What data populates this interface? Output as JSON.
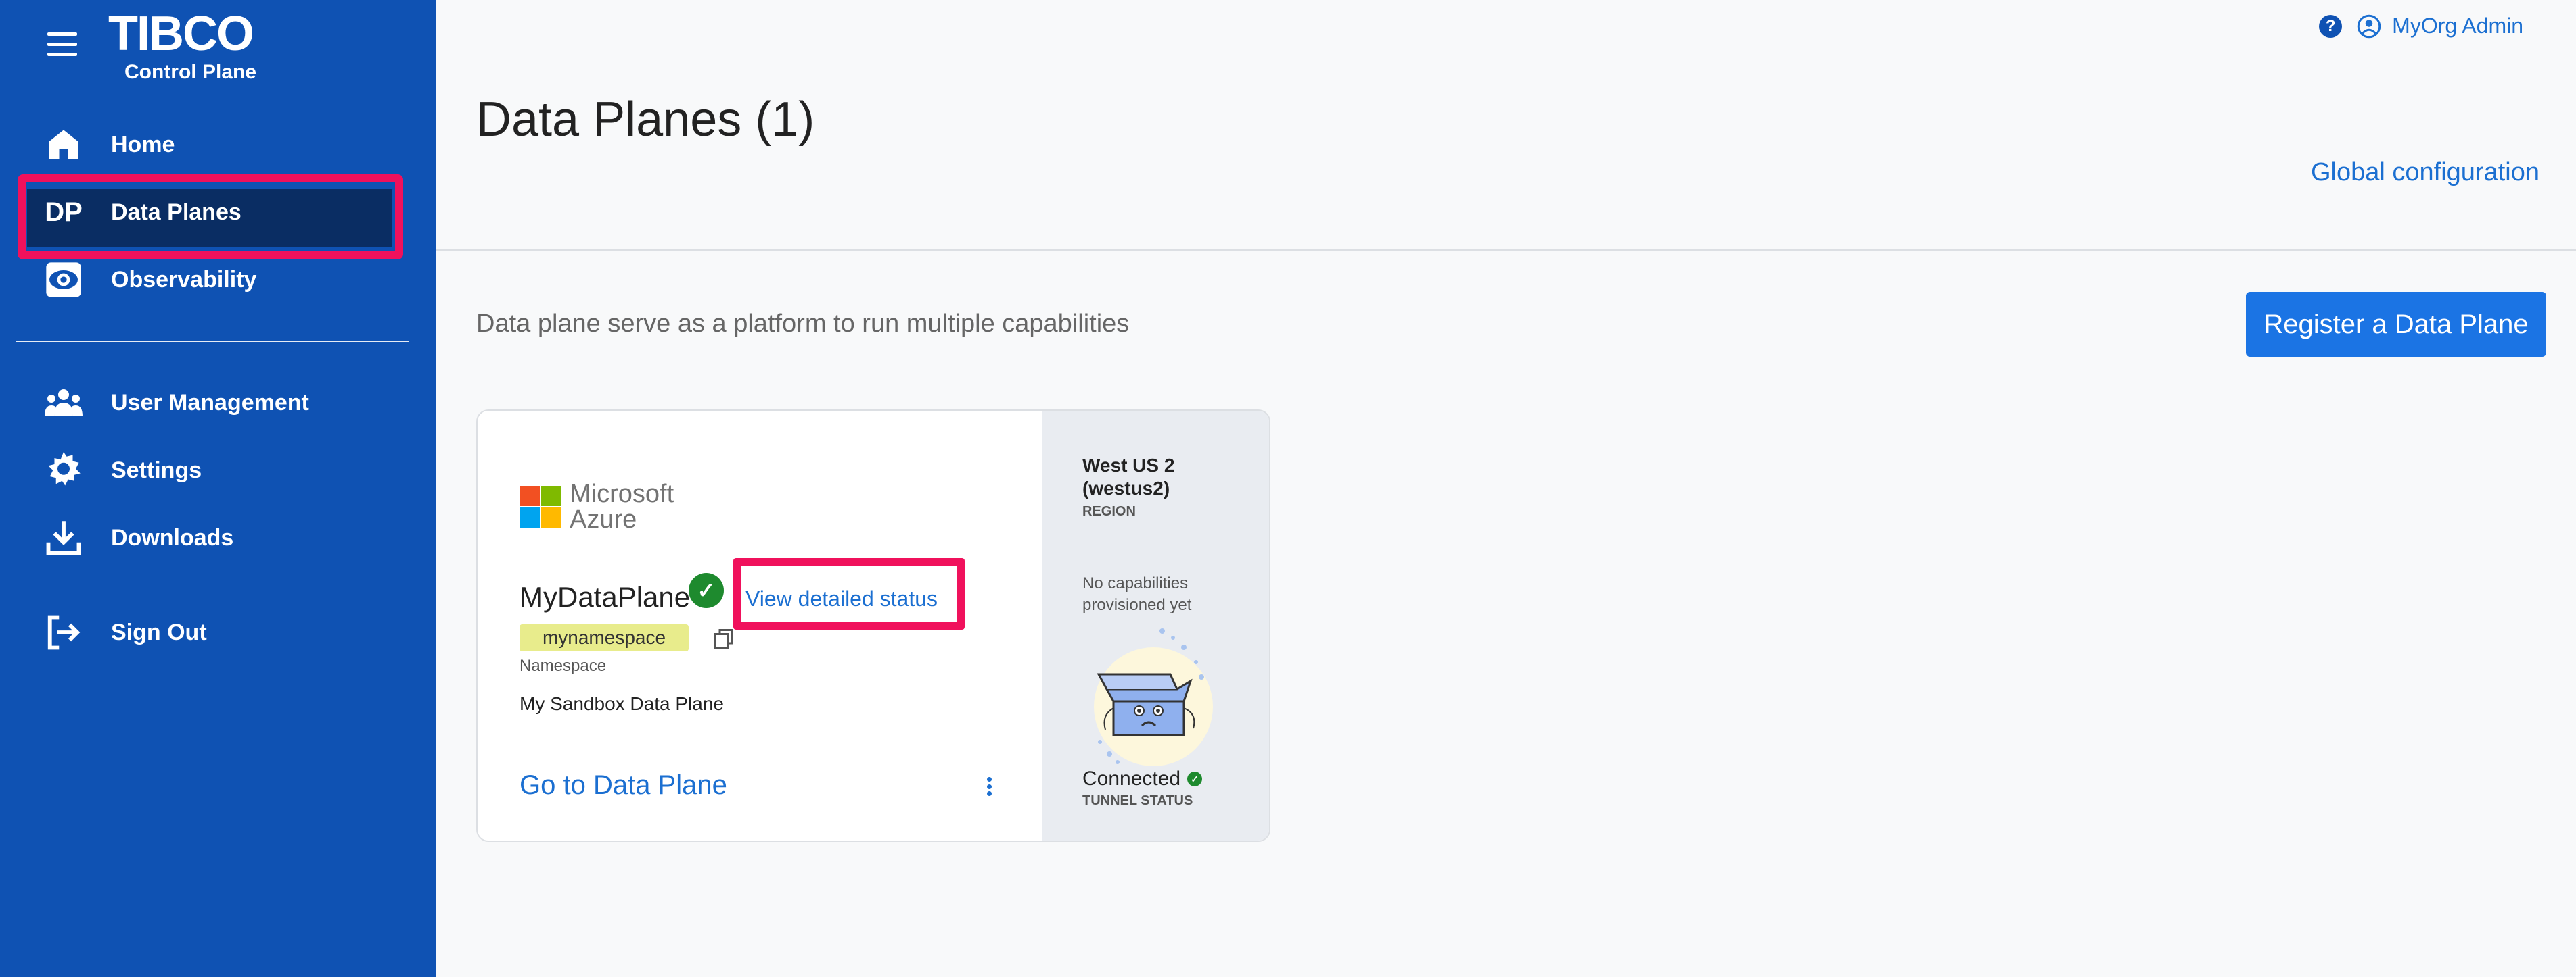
{
  "brand": {
    "name": "TIBCO",
    "sub": "Control Plane"
  },
  "sidebar": {
    "items": [
      {
        "label": "Home",
        "icon": "home-icon"
      },
      {
        "label": "Data Planes",
        "icon": "dp-icon",
        "icon_text": "DP",
        "active": true
      },
      {
        "label": "Observability",
        "icon": "observability-icon"
      },
      {
        "label": "User Management",
        "icon": "users-icon"
      },
      {
        "label": "Settings",
        "icon": "gear-icon"
      },
      {
        "label": "Downloads",
        "icon": "download-icon"
      },
      {
        "label": "Sign Out",
        "icon": "sign-out-icon"
      }
    ]
  },
  "topbar": {
    "help": "?",
    "user": "MyOrg Admin"
  },
  "header": {
    "title": "Data Planes (1)",
    "global_config": "Global configuration",
    "subtitle": "Data plane serve as a platform to run multiple capabilities",
    "register_button": "Register a Data Plane"
  },
  "card": {
    "provider_line1": "Microsoft",
    "provider_line2": "Azure",
    "name": "MyDataPlane",
    "view_status": "View detailed status",
    "namespace": "mynamespace",
    "namespace_label": "Namespace",
    "description": "My Sandbox Data Plane",
    "go_link": "Go to Data Plane",
    "region_name": "West US 2 (westus2)",
    "region_label": "REGION",
    "capabilities": "No capabilities provisioned yet",
    "tunnel_status": "Connected",
    "tunnel_label": "TUNNEL STATUS"
  },
  "colors": {
    "sidebar": "#0f52b3",
    "accent": "#1b74e4",
    "highlight": "#f0115c",
    "success": "#1e8a2e"
  }
}
